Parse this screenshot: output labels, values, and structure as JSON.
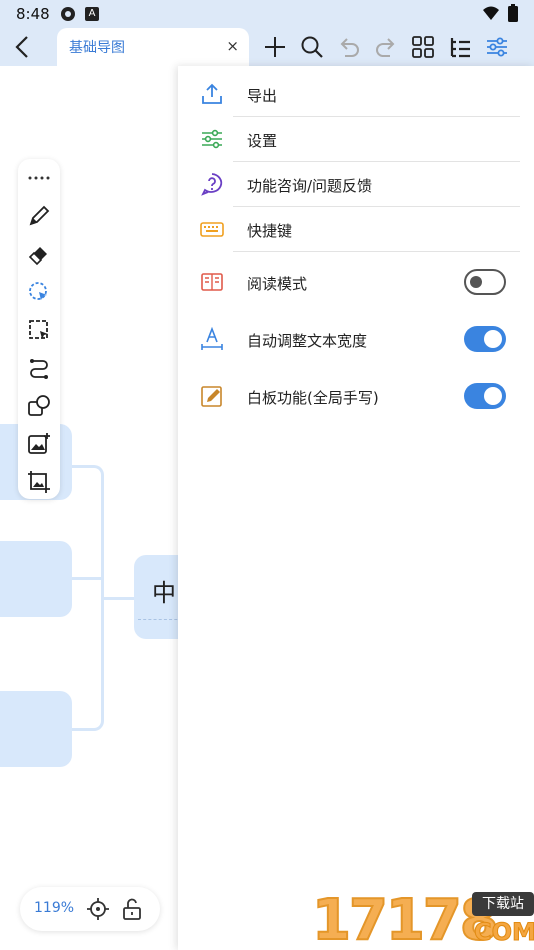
{
  "status": {
    "time": "8:48",
    "notif_badge": "A"
  },
  "toolbar": {
    "tab_title": "基础导图",
    "tab_close": "×"
  },
  "canvas": {
    "center_node_text": "中"
  },
  "menu": {
    "items": [
      {
        "label": "导出",
        "icon": "export-icon"
      },
      {
        "label": "设置",
        "icon": "settings-sliders-icon"
      },
      {
        "label": "功能咨询/问题反馈",
        "icon": "help-icon"
      },
      {
        "label": "快捷键",
        "icon": "keyboard-icon"
      },
      {
        "label": "阅读模式",
        "icon": "book-icon",
        "toggle": false
      },
      {
        "label": "自动调整文本宽度",
        "icon": "text-width-icon",
        "toggle": true
      },
      {
        "label": "白板功能(全局手写)",
        "icon": "whiteboard-pen-icon",
        "toggle": true
      }
    ]
  },
  "zoom": {
    "level": "119%"
  },
  "watermark": {
    "digits": "17178",
    "badge": "下载站",
    "suffix": "COM"
  },
  "colors": {
    "accent": "#3a84e0",
    "header_bg": "#dde9f8",
    "node_bg": "#d8e8fb"
  }
}
